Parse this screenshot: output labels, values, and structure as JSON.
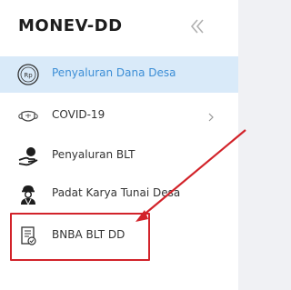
{
  "brand": {
    "title": "MONEV-DD"
  },
  "sidebar": {
    "items": [
      {
        "label": "Penyaluran Dana Desa",
        "icon": "rupiah-coin-icon",
        "active": true,
        "has_submenu": false
      },
      {
        "label": "COVID-19",
        "icon": "face-mask-icon",
        "active": false,
        "has_submenu": true
      },
      {
        "label": "Penyaluran BLT",
        "icon": "hand-money-icon",
        "active": false,
        "has_submenu": false
      },
      {
        "label": "Padat Karya Tunai Desa",
        "icon": "worker-icon",
        "active": false,
        "has_submenu": false
      },
      {
        "label": "BNBA BLT DD",
        "icon": "document-list-icon",
        "active": false,
        "has_submenu": false
      }
    ]
  },
  "colors": {
    "active_background": "#d9eaf9",
    "active_text": "#3c8ed6",
    "annotation_red": "#d2232a"
  }
}
